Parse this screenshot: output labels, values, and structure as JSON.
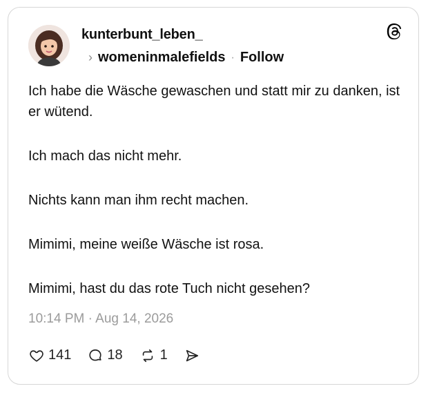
{
  "post": {
    "author": "kunterbunt_leben_",
    "community": "womeninmalefields",
    "separator": "·",
    "follow_label": "Follow",
    "paragraphs": [
      "Ich habe die Wäsche gewaschen und statt mir zu danken, ist er wütend.",
      "Ich mach das nicht mehr.",
      "Nichts kann man ihm recht machen.",
      "Mimimi, meine weiße Wäsche ist rosa.",
      "Mimimi, hast du das rote Tuch nicht gesehen?"
    ],
    "timestamp": "10:14 PM · Aug 14, 2026"
  },
  "actions": {
    "likes": "141",
    "replies": "18",
    "reposts": "1"
  },
  "icons": {
    "brand": "threads-icon",
    "chevron": "chevron-right-icon",
    "like": "heart-icon",
    "reply": "comment-icon",
    "repost": "repost-icon",
    "share": "send-icon"
  },
  "colors": {
    "text": "#111111",
    "muted": "#9b9b9b",
    "border": "#d6d6d6"
  }
}
